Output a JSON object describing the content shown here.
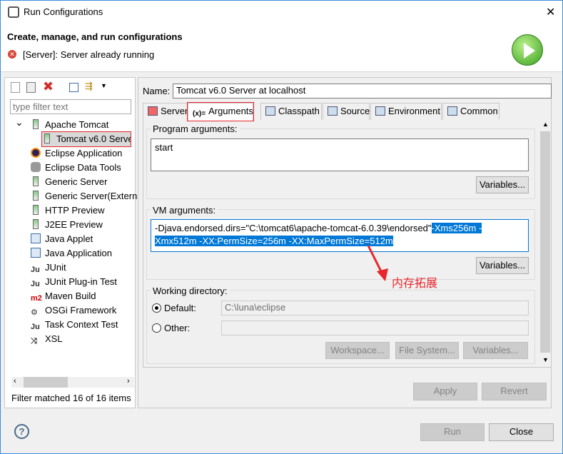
{
  "window": {
    "title": "Run Configurations",
    "close": "✕"
  },
  "header": {
    "heading": "Create, manage, and run configurations",
    "message": "[Server]: Server already running"
  },
  "left": {
    "filter_placeholder": "type filter text",
    "status": "Filter matched 16 of 16 items",
    "tree": [
      {
        "label": "Apache Tomcat",
        "icon": "server-icon",
        "expanded": true
      },
      {
        "label": "Tomcat v6.0 Serve",
        "icon": "server-icon",
        "child": true,
        "selected": true
      },
      {
        "label": "Eclipse Application",
        "icon": "eclipse-icon"
      },
      {
        "label": "Eclipse Data Tools",
        "icon": "database-icon"
      },
      {
        "label": "Generic Server",
        "icon": "server-icon"
      },
      {
        "label": "Generic Server(Extern",
        "icon": "server-icon"
      },
      {
        "label": "HTTP Preview",
        "icon": "server-icon"
      },
      {
        "label": "J2EE Preview",
        "icon": "server-icon"
      },
      {
        "label": "Java Applet",
        "icon": "applet-icon"
      },
      {
        "label": "Java Application",
        "icon": "java-app-icon"
      },
      {
        "label": "JUnit",
        "icon": "junit-icon",
        "glyph": "Ju"
      },
      {
        "label": "JUnit Plug-in Test",
        "icon": "junit-plugin-icon",
        "glyph": "Ju"
      },
      {
        "label": "Maven Build",
        "icon": "maven-icon",
        "glyph": "m2"
      },
      {
        "label": "OSGi Framework",
        "icon": "osgi-icon",
        "glyph": "⚙"
      },
      {
        "label": "Task Context Test",
        "icon": "task-icon",
        "glyph": "Ju"
      },
      {
        "label": "XSL",
        "icon": "xsl-icon",
        "glyph": "⤨"
      }
    ]
  },
  "right": {
    "name_label": "Name:",
    "name_value": "Tomcat v6.0 Server at localhost",
    "tabs": [
      {
        "label": "Server"
      },
      {
        "label": "Arguments",
        "glyph": "(x)="
      },
      {
        "label": "Classpath"
      },
      {
        "label": "Source"
      },
      {
        "label": "Environment"
      },
      {
        "label": "Common"
      }
    ],
    "program_args_label": "Program arguments:",
    "program_args_value": "start",
    "vm_args_label": "VM arguments:",
    "vm_args_plain": "-Djava.endorsed.dirs=\"C:\\tomcat6\\apache-tomcat-6.0.39\\endorsed\"",
    "vm_args_selected_1": "-Xms256m -",
    "vm_args_selected_2": "Xmx512m -XX:PermSize=256m -XX:MaxPermSize=512m",
    "variables": "Variables...",
    "annotation": "内存拓展",
    "workdir_label": "Working directory:",
    "default_label": "Default:",
    "default_value": "C:\\luna\\eclipse",
    "other_label": "Other:",
    "workspace": "Workspace...",
    "filesystem": "File System...",
    "apply": "Apply",
    "revert": "Revert"
  },
  "footer": {
    "help": "?",
    "run": "Run",
    "close": "Close"
  },
  "colors": {
    "selection": "#0078d7",
    "annotation": "#e8262b"
  }
}
